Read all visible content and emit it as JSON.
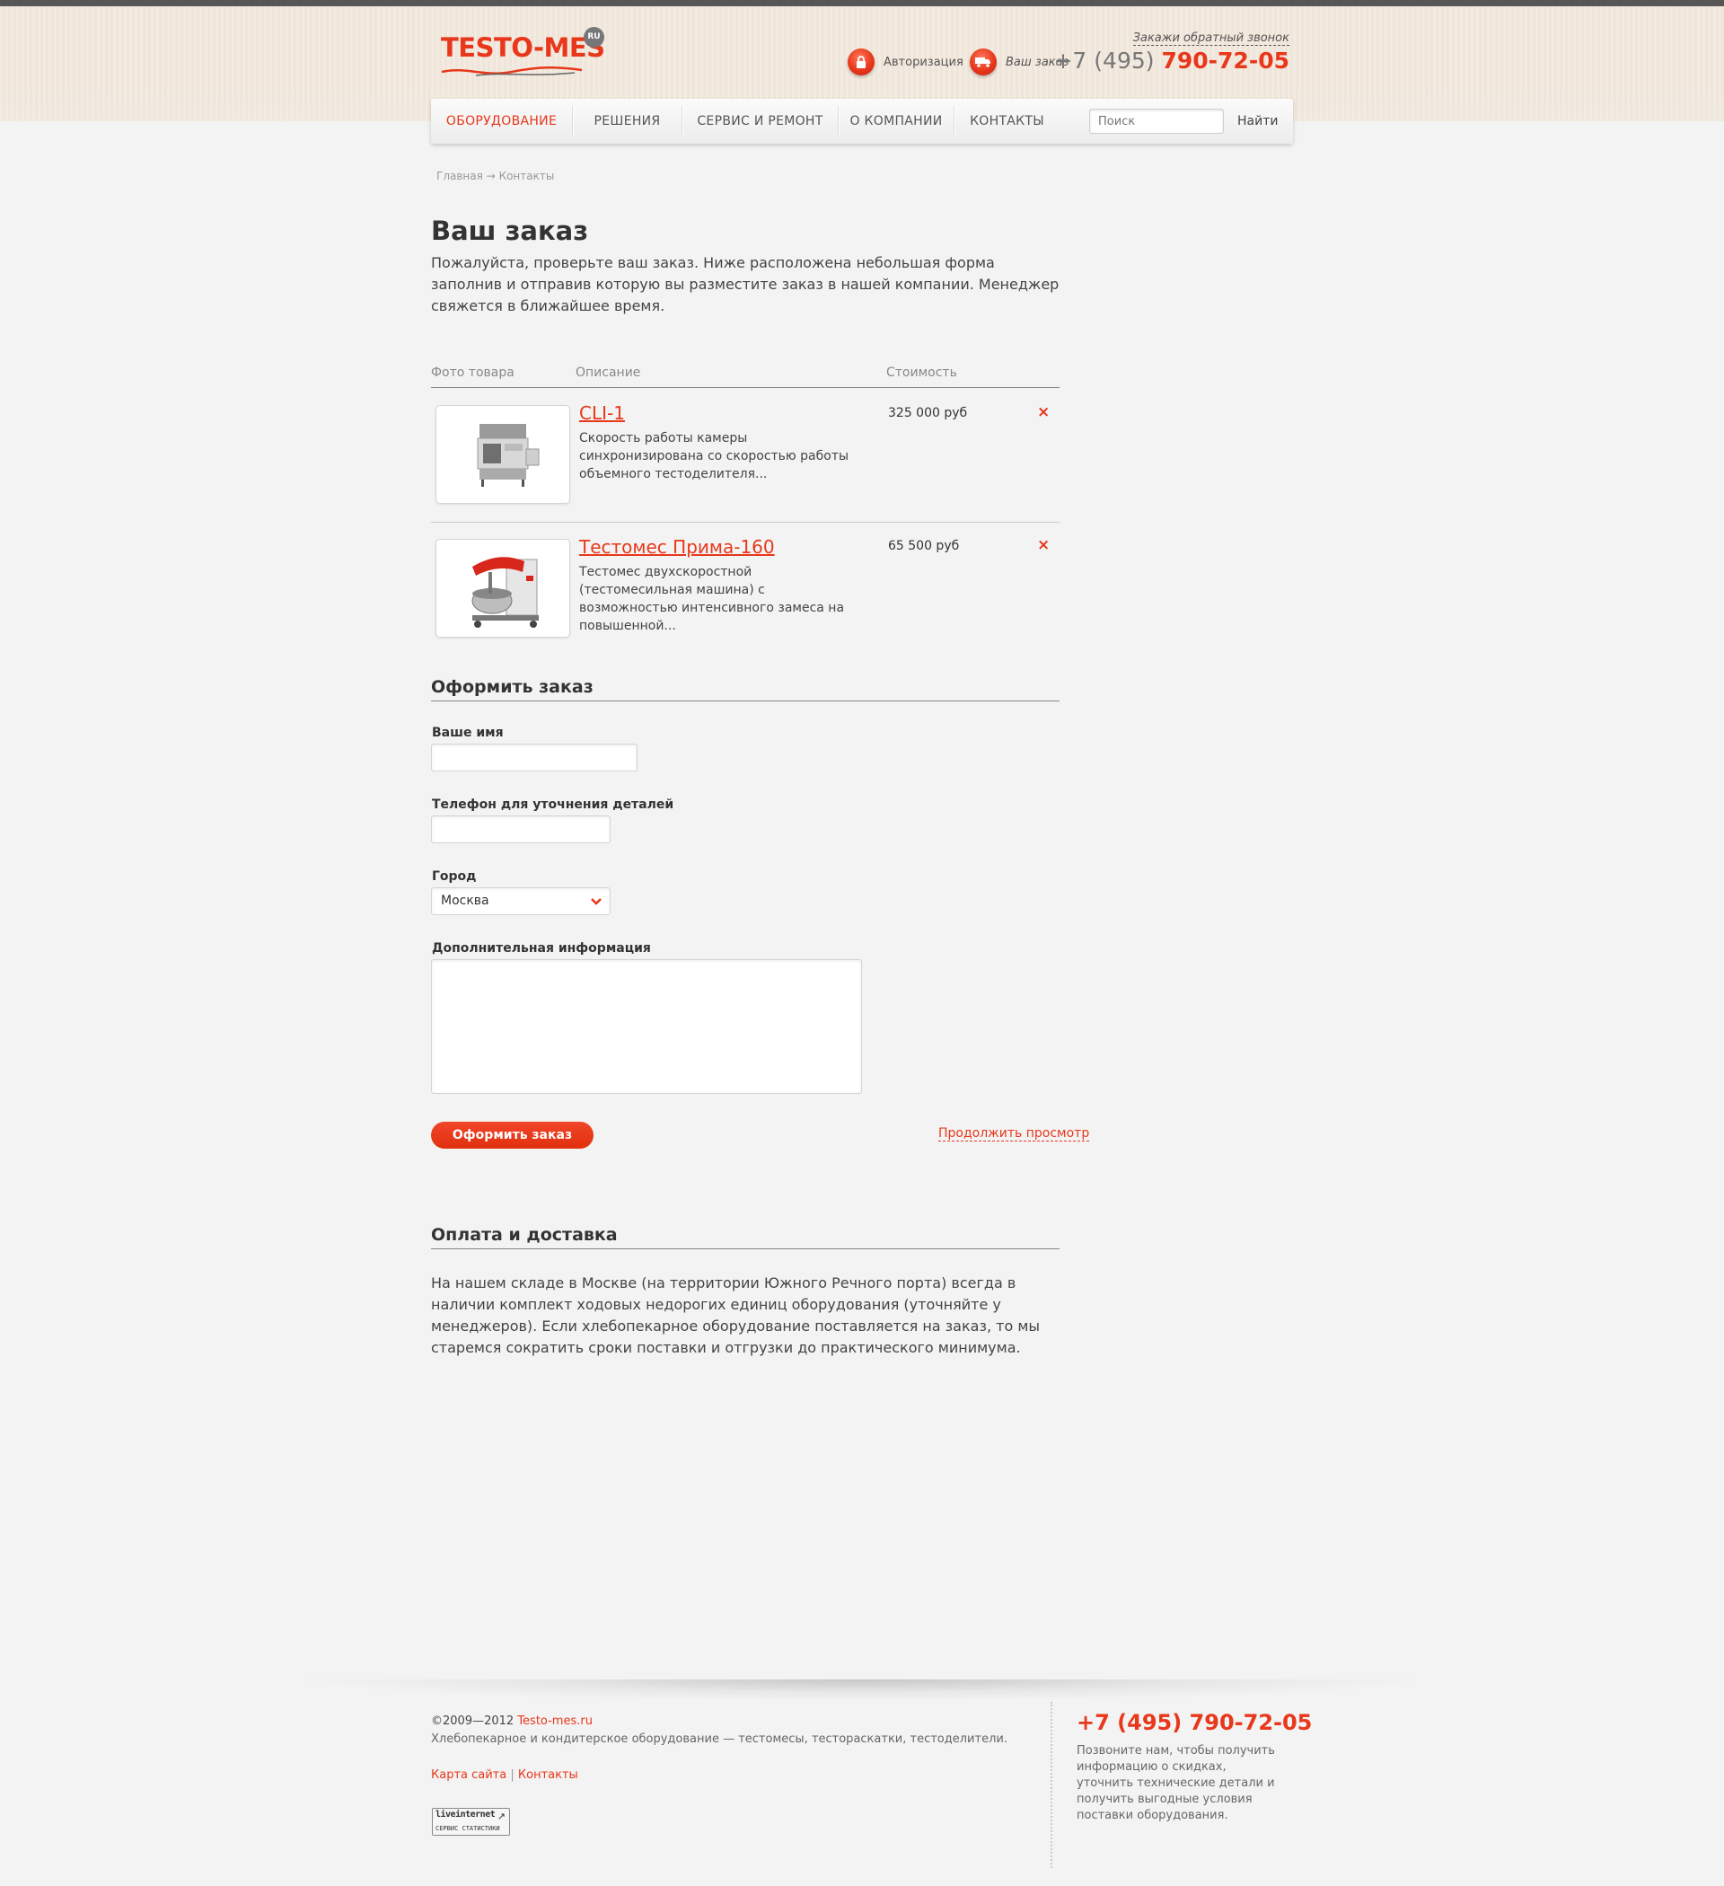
{
  "header": {
    "logo_text": "TESTO-MES",
    "logo_badge": "RU",
    "auth_label": "Авторизация",
    "order_label": "Ваш заказ",
    "callback_label": "Закажи обратный звонок",
    "phone_prefix": "+7 (495)",
    "phone_number": "790-72-05"
  },
  "nav": {
    "items": [
      {
        "label": "ОБОРУДОВАНИЕ",
        "active": true
      },
      {
        "label": "РЕШЕНИЯ",
        "active": false
      },
      {
        "label": "СЕРВИС И РЕМОНТ",
        "active": false
      },
      {
        "label": "О КОМПАНИИ",
        "active": false
      },
      {
        "label": "КОНТАКТЫ",
        "active": false
      }
    ],
    "search_placeholder": "Поиск",
    "search_button": "Найти"
  },
  "breadcrumb": {
    "home": "Главная",
    "arrow": "→",
    "current": "Контакты"
  },
  "page": {
    "title": "Ваш заказ",
    "intro": "Пожалуйста, проверьте ваш заказ. Ниже расположена небольшая форма заполнив и отправив которую вы разместите заказ в нашей компании. Менеджер свяжется в ближайшее время."
  },
  "cart": {
    "columns": {
      "photo": "Фото товара",
      "description": "Описание",
      "price": "Стоимость"
    },
    "items": [
      {
        "name": "CLI-1",
        "description": "Скорость работы камеры синхронизирована со скоростью работы объемного тестоделителя...",
        "price": "325 000 руб",
        "remove_icon": "×"
      },
      {
        "name": "Тестомес Прима-160",
        "description": "Тестомес двухскоростной (тестомесильная машина) с возможностью интенсивного замеса на повышенной...",
        "price": "65 500 руб",
        "remove_icon": "×"
      }
    ]
  },
  "form": {
    "title": "Оформить заказ",
    "name_label": "Ваше имя",
    "name_value": "",
    "phone_label": "Телефон для уточнения деталей",
    "phone_value": "",
    "city_label": "Город",
    "city_value": "Москва",
    "info_label": "Дополнительная информация",
    "info_value": "",
    "submit_label": "Оформить заказ",
    "continue_label": "Продолжить просмотр"
  },
  "delivery": {
    "title": "Оплата и доставка",
    "text": "На нашем складе в Москве (на территории Южного Речного порта) всегда в наличии комплект ходовых недорогих единиц оборудования (уточняйте у менеджеров). Если хлебопекарное оборудование поставляется на заказ, то мы старемся сократить сроки поставки и отгрузки до практического минимума."
  },
  "footer": {
    "copyright": "©2009—2012",
    "site_link": "Testo-mes.ru",
    "description": "Хлебопекарное и кондитерское оборудование — тестомесы, тестораскатки, тестоделители.",
    "sitemap_link": "Карта сайта",
    "separator": "|",
    "contacts_link": "Контакты",
    "counter_top": "liveinternet",
    "counter_bottom": "СЕРВИС СТАТИСТИКИ",
    "phone": "+7 (495) 790-72-05",
    "note": "Позвоните нам, чтобы получить информацию о скидках, уточнить технические детали и получить выгодные условия поставки оборудования."
  },
  "colors": {
    "accent": "#e8371b",
    "text": "#333333",
    "background": "#f3f3f3"
  }
}
